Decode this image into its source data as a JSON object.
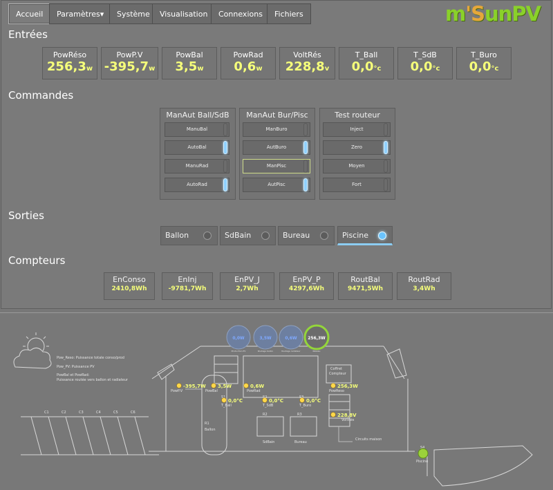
{
  "nav": {
    "items": [
      "Accueil",
      "Paramètres",
      "Système",
      "Visualisation",
      "Connexions",
      "Fichiers"
    ],
    "caret": "▾",
    "active": "Accueil"
  },
  "logo": {
    "prefix": "m",
    "accent": "'S",
    "rest": "unPV"
  },
  "entrees": {
    "title": "Entrées",
    "tiles": [
      {
        "label": "PowRéso",
        "value": "256,3",
        "unit": "w"
      },
      {
        "label": "PowP.V",
        "value": "-395,7",
        "unit": "w"
      },
      {
        "label": "PowBal",
        "value": "3,5",
        "unit": "w"
      },
      {
        "label": "PowRad",
        "value": "0,6",
        "unit": "w"
      },
      {
        "label": "VoltRés",
        "value": "228,8",
        "unit": "v"
      },
      {
        "label": "T_Ball",
        "value": "0,0",
        "unit": "°c"
      },
      {
        "label": "T_SdB",
        "value": "0,0",
        "unit": "°c"
      },
      {
        "label": "T_Buro",
        "value": "0,0",
        "unit": "°c"
      }
    ]
  },
  "commandes": {
    "title": "Commandes",
    "groups": [
      {
        "title": "ManAut Ball/SdB",
        "buttons": [
          {
            "label": "ManuBal",
            "on": false
          },
          {
            "label": "AutoBal",
            "on": true
          },
          {
            "label": "ManuRad",
            "on": false
          },
          {
            "label": "AutoRad",
            "on": true
          }
        ]
      },
      {
        "title": "ManAut Bur/Pisc",
        "buttons": [
          {
            "label": "ManBuro",
            "on": false
          },
          {
            "label": "AutBuro",
            "on": true
          },
          {
            "label": "ManPisc",
            "on": false
          },
          {
            "label": "AutPisc",
            "on": true
          }
        ]
      },
      {
        "title": "Test routeur",
        "buttons": [
          {
            "label": "Inject",
            "on": false
          },
          {
            "label": "Zero",
            "on": true
          },
          {
            "label": "Moyen",
            "on": false
          },
          {
            "label": "Fort",
            "on": false
          }
        ]
      }
    ]
  },
  "sorties": {
    "title": "Sorties",
    "items": [
      {
        "label": "Ballon",
        "on": false
      },
      {
        "label": "SdBain",
        "on": false
      },
      {
        "label": "Bureau",
        "on": false
      },
      {
        "label": "Piscine",
        "on": true
      }
    ]
  },
  "compteurs": {
    "title": "Compteurs",
    "items": [
      {
        "label": "EnConso",
        "value": "2410,8Wh"
      },
      {
        "label": "EnInj",
        "value": "-9781,7Wh"
      },
      {
        "label": "EnPV_J",
        "value": "2,7Wh"
      },
      {
        "label": "EnPV_P",
        "value": "4297,6Wh"
      },
      {
        "label": "RoutBal",
        "value": "9471,5Wh"
      },
      {
        "label": "RoutRad",
        "value": "3,4Wh"
      }
    ]
  },
  "diagram": {
    "gauges": [
      {
        "value": "0,0W",
        "caption": "Production PV"
      },
      {
        "value": "3,5W",
        "caption": "Routage ballon"
      },
      {
        "value": "0,6W",
        "caption": "Routage radiateur"
      },
      {
        "value": "256,3W",
        "caption": "Réseau"
      }
    ],
    "legend": [
      "Pow_Reso: Puissance totale conso/prod",
      "Pow_PV: Puissance PV",
      "PowBal et PowRad:",
      "Puissance routée vers ballon et radiateur"
    ],
    "readouts": {
      "pv": "-395,7W",
      "bal": "3,5W",
      "rad": "0,6W",
      "reso": "256,3W",
      "volt": "228,8V",
      "tball": "0,0°C",
      "tsdb": "0,0°C",
      "tburo": "0,0°C"
    },
    "labels": {
      "powpv": "PowP.V",
      "powbal": "PowBal",
      "powrad": "PowRad",
      "powreso": "PowReso",
      "voltres": "VoltRés",
      "tball": "T_Ball",
      "tsdb": "T_SdB",
      "tburo": "T_Buro",
      "coffret": "Coffret",
      "compteur": "Compteur",
      "ballon": "Ballon",
      "sdbain": "SdBain",
      "bureau": "Bureau",
      "piscine": "Piscine",
      "circuits": "Circuits maison",
      "r1": "R1",
      "r2": "R2",
      "r3": "R3",
      "s1": "S1",
      "s2": "S2",
      "s3": "S3",
      "s4": "S4"
    },
    "panels": [
      "C1",
      "C2",
      "C3",
      "C4",
      "C5",
      "C6"
    ]
  },
  "colors": {
    "accent": "#f6ff7a",
    "led_on": "#8fd0ff",
    "logo_green": "#8ad12a",
    "logo_orange": "#e6a73a"
  }
}
